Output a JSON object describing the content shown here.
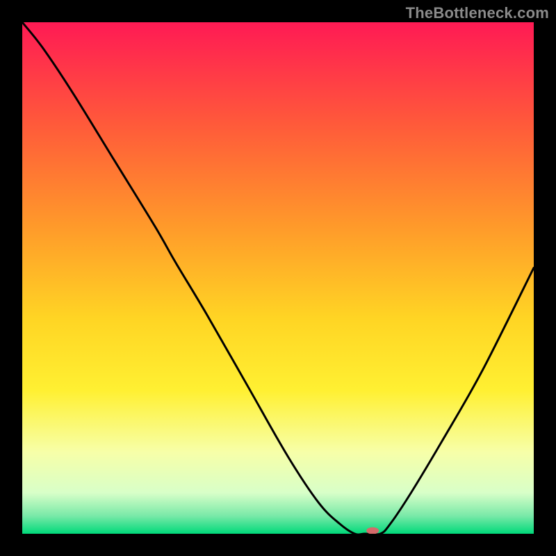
{
  "watermark": "TheBottleneck.com",
  "chart_data": {
    "type": "line",
    "title": "",
    "xlabel": "",
    "ylabel": "",
    "xlim": [
      0,
      100
    ],
    "ylim": [
      0,
      100
    ],
    "grid": false,
    "legend": false,
    "gradient_stops": [
      {
        "offset": 0.0,
        "color": "#ff1a54"
      },
      {
        "offset": 0.2,
        "color": "#ff5a3a"
      },
      {
        "offset": 0.4,
        "color": "#ff9a2a"
      },
      {
        "offset": 0.58,
        "color": "#ffd524"
      },
      {
        "offset": 0.72,
        "color": "#fff032"
      },
      {
        "offset": 0.84,
        "color": "#f7ffa8"
      },
      {
        "offset": 0.92,
        "color": "#d8ffc8"
      },
      {
        "offset": 0.965,
        "color": "#79e9a8"
      },
      {
        "offset": 1.0,
        "color": "#00d97a"
      }
    ],
    "series": [
      {
        "name": "bottleneck-curve",
        "x": [
          0,
          4,
          10,
          18,
          26,
          30,
          36,
          44,
          52,
          58,
          62,
          65,
          67,
          70,
          72,
          76,
          82,
          90,
          100
        ],
        "y": [
          100,
          95,
          86,
          73,
          60,
          53,
          43,
          29,
          15,
          6,
          2,
          0,
          0,
          0,
          2,
          8,
          18,
          32,
          52
        ]
      }
    ],
    "marker": {
      "x": 68.5,
      "y": 0.6,
      "color": "#d46a6a",
      "rx": 9,
      "ry": 5
    }
  }
}
